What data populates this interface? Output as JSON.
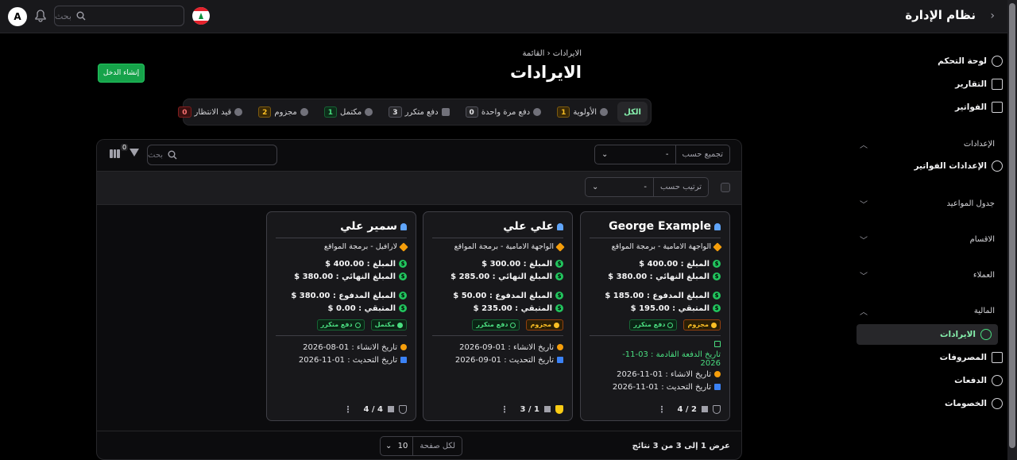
{
  "app": {
    "title": "نظام الإدارة",
    "user_initial": "A",
    "search_placeholder": "بحث"
  },
  "sidebar": {
    "top": [
      {
        "label": "لوحة التحكم",
        "icon": "dollar-circle-icon"
      },
      {
        "label": "التقارير",
        "icon": "bar-chart-icon"
      },
      {
        "label": "الفواتير",
        "icon": "invoice-icon"
      }
    ],
    "groups": [
      {
        "label": "الإعدادات",
        "expanded": true,
        "items": [
          {
            "label": "الإعدادات الفواتير",
            "icon": "gear-icon"
          }
        ]
      },
      {
        "label": "جدول المواعيد",
        "expanded": false
      },
      {
        "label": "الاقسام",
        "expanded": false
      },
      {
        "label": "العملاء",
        "expanded": false
      },
      {
        "label": "المالية",
        "expanded": true,
        "items": [
          {
            "label": "الايرادات",
            "icon": "trend-up-icon",
            "active": true
          },
          {
            "label": "المصروفات",
            "icon": "trend-down-icon"
          },
          {
            "label": "الدفعات",
            "icon": "dollar-circle-icon"
          },
          {
            "label": "الخصومات",
            "icon": "percent-icon"
          }
        ]
      }
    ]
  },
  "page": {
    "breadcrumb": [
      "الايرادات",
      "القائمة"
    ],
    "title": "الايرادات",
    "create_label": "إنشاء الدخل"
  },
  "tabs": [
    {
      "label": "الكل",
      "count": "",
      "selected": true
    },
    {
      "label": "الأولوية",
      "count": "1",
      "badge": "amber"
    },
    {
      "label": "دفع مرة واحدة",
      "count": "0",
      "badge": "gray"
    },
    {
      "label": "دفع متكرر",
      "count": "3",
      "badge": "gray"
    },
    {
      "label": "مكتمل",
      "count": "1",
      "badge": "green"
    },
    {
      "label": "مجزوم",
      "count": "2",
      "badge": "amber"
    },
    {
      "label": "قيد الانتظار",
      "count": "0",
      "badge": "red"
    }
  ],
  "toolbar": {
    "group_by_label": "تجميع حسب",
    "group_by_value": "-",
    "search_placeholder": "بحث",
    "filter_count": "0",
    "sort_by_label": "ترتيب حسب",
    "sort_by_value": "-"
  },
  "cards": [
    {
      "name": "George Example",
      "category": "الواجهة الامامية - برمجة المواقع",
      "amount": "المبلغ : 400.00 $",
      "final": "المبلغ النهائي : 380.00 $",
      "paid": "المبلغ المدفوع : 185.00 $",
      "remaining": "المتبقي : 195.00 $",
      "status": "مجزوم",
      "type": "دفع متكرر",
      "next_payment": "تاريخ الدفعة القادمة : 03-11-2026",
      "created": "تاريخ الانشاء : 01-11-2026",
      "updated": "تاريخ التحديث : 01-11-2026",
      "progress": "2 / 4",
      "priority": false
    },
    {
      "name": "علي علي",
      "category": "الواجهة الامامية - برمجة المواقع",
      "amount": "المبلغ : 300.00 $",
      "final": "المبلغ النهائي : 285.00 $",
      "paid": "المبلغ المدفوع : 50.00 $",
      "remaining": "المتبقي : 235.00 $",
      "status": "مجزوم",
      "type": "دفع متكرر",
      "next_payment": "",
      "created": "تاريخ الانشاء : 01-09-2026",
      "updated": "تاريخ التحديث : 01-09-2026",
      "progress": "1 / 3",
      "priority": true
    },
    {
      "name": "سمير علي",
      "category": "لارافيل - برمجة المواقع",
      "amount": "المبلغ : 400.00 $",
      "final": "المبلغ النهائي : 380.00 $",
      "paid": "المبلغ المدفوع : 380.00 $",
      "remaining": "المتبقي : 0.00 $",
      "status": "مكتمل",
      "type": "دفع متكرر",
      "next_payment": "",
      "created": "تاريخ الانشاء : 01-08-2026",
      "updated": "تاريخ التحديث : 01-11-2026",
      "progress": "4 / 4",
      "priority": false
    }
  ],
  "footer": {
    "info": "عرض 1 إلى 3 من 3 نتائج",
    "per_page_label": "لكل صفحة",
    "per_page_value": "10"
  },
  "colors": {
    "accent": "#16a34a",
    "background": "#000000",
    "card": "#18181b"
  }
}
